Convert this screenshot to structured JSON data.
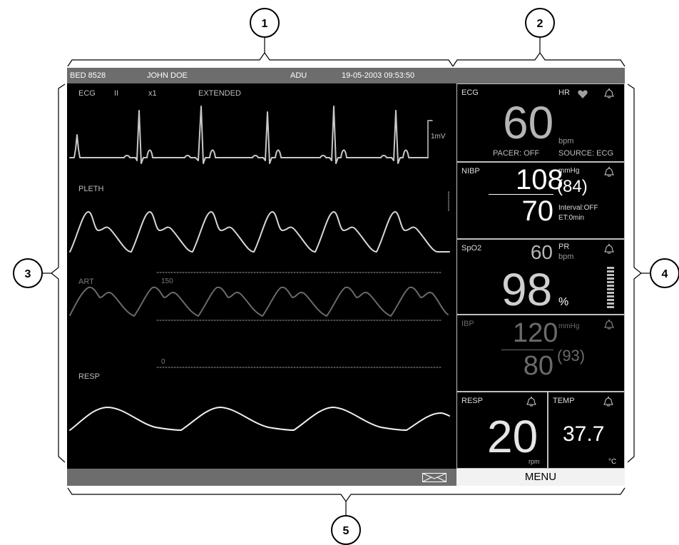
{
  "callouts": [
    "1",
    "2",
    "3",
    "4",
    "5"
  ],
  "header": {
    "bed": "BED   8528",
    "patient": "JOHN DOE",
    "patient_type": "ADU",
    "datetime": "19-05-2003 09:53:50"
  },
  "waveforms": {
    "ecg": {
      "label": "ECG",
      "lead": "II",
      "gain": "x1",
      "mode": "EXTENDED",
      "scale": "1mV"
    },
    "pleth": {
      "label": "PLETH"
    },
    "art": {
      "label": "ART",
      "scale_high": "150",
      "scale_low": "0"
    },
    "resp": {
      "label": "RESP"
    }
  },
  "params": {
    "ecg": {
      "label": "ECG",
      "hr_label": "HR",
      "value": "60",
      "unit": "bpm",
      "pacer": "PACER: OFF",
      "source": "SOURCE: ECG",
      "icons": [
        "heart-icon",
        "alarm-bell-icon"
      ]
    },
    "nibp": {
      "label": "NIBP",
      "systolic": "108",
      "diastolic": "70",
      "unit": "mmHg",
      "mean": "(84)",
      "interval": "Interval:OFF",
      "et": "ET:0min"
    },
    "spo2": {
      "label": "SpO2",
      "pr_value": "60",
      "pr_label": "PR",
      "pr_unit": "bpm",
      "value": "98",
      "unit": "%"
    },
    "ibp": {
      "label": "IBP",
      "systolic": "120",
      "diastolic": "80",
      "unit": "mmHg",
      "mean": "(93)"
    },
    "resp": {
      "label": "RESP",
      "value": "20",
      "unit": "rpm"
    },
    "temp": {
      "label": "TEMP",
      "value": "37.7",
      "unit": "°C"
    }
  },
  "footer": {
    "menu_label": "MENU",
    "icons": [
      "message-envelope-icon"
    ]
  },
  "colors": {
    "background": "#000000",
    "bar": "#6d6d6d",
    "trace": "#c8c8c8",
    "ibp_dim": "#6a6a6a"
  }
}
